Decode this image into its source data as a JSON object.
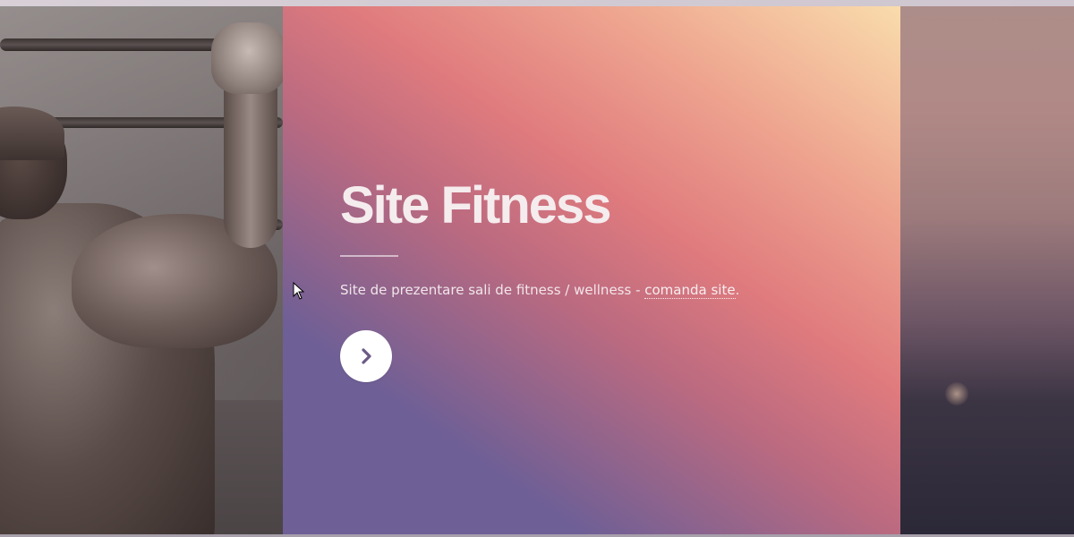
{
  "hero": {
    "title": "Site Fitness",
    "description_prefix": "Site de prezentare sali de fitness / wellness - ",
    "link_text": "comanda site",
    "description_suffix": ".",
    "next_button_icon": "chevron-right-icon"
  },
  "colors": {
    "gradient_purple": "#6e5f96",
    "gradient_pink": "#e07b7e",
    "gradient_peach": "#f9dcac",
    "button_bg": "#ffffff",
    "button_icon": "#6b5a86"
  }
}
